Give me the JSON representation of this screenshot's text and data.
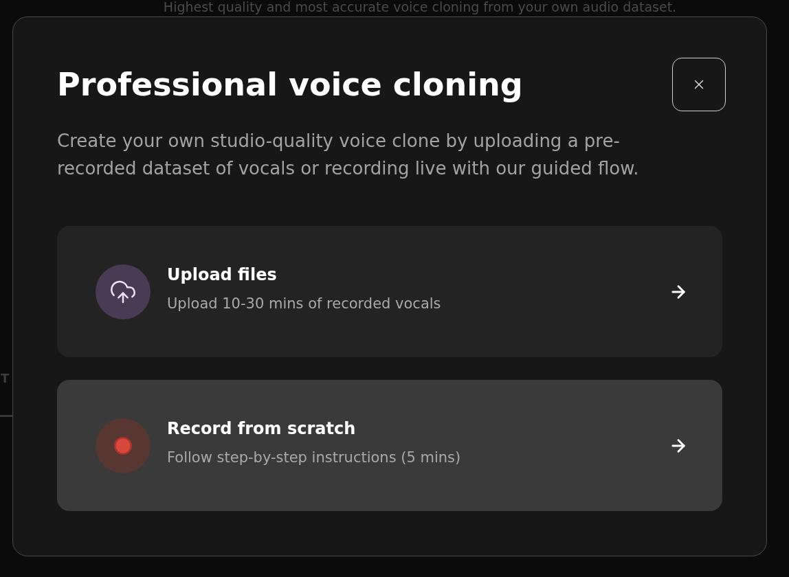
{
  "background": {
    "subtitle": "Highest quality and most accurate voice cloning from your own audio dataset.",
    "tab_label": "T"
  },
  "dialog": {
    "title": "Professional voice cloning",
    "description": "Create your own studio-quality voice clone by uploading a pre-recorded dataset of vocals or recording live with our guided flow.",
    "options": [
      {
        "kind": "upload",
        "title": "Upload files",
        "description": "Upload 10-30 mins of recorded vocals",
        "highlighted": false
      },
      {
        "kind": "record",
        "title": "Record from scratch",
        "description": "Follow step-by-step instructions (5 mins)",
        "highlighted": true
      }
    ]
  }
}
